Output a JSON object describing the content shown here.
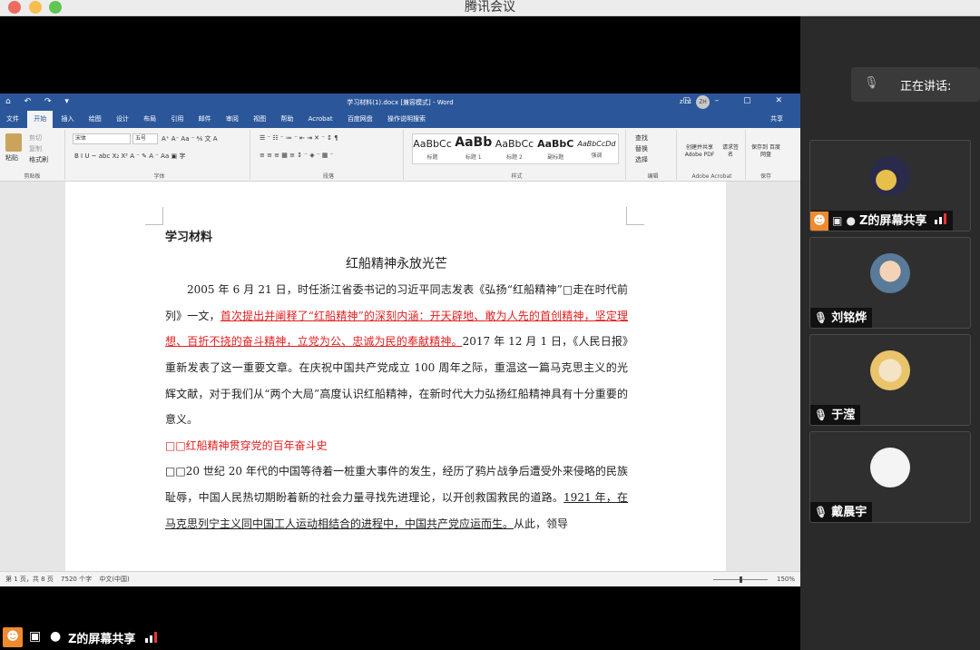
{
  "window": {
    "title": "腾讯会议",
    "colors": {
      "close": "#ed6a5e",
      "minimize": "#f5bf4f",
      "zoom": "#61c554"
    }
  },
  "word": {
    "doc_title": "学习材料(1).docx [兼容模式] - Word",
    "user": "z ht",
    "user_initials": "ZH",
    "quick_access": "⌂ ↶ ↷ ▾",
    "window_buttons": "▢ – ▢ ✕",
    "tabs": [
      "文件",
      "开始",
      "插入",
      "绘图",
      "设计",
      "布局",
      "引用",
      "邮件",
      "审阅",
      "视图",
      "帮助",
      "Acrobat",
      "百度网盘",
      "操作说明搜索"
    ],
    "active_tab": "开始",
    "share": "共享",
    "ribbon": {
      "clipboard": {
        "paste": "粘贴",
        "cut": "剪切",
        "copy": "复制",
        "format_painter": "格式刷",
        "label": "剪贴板"
      },
      "font": {
        "name": "宋体",
        "size": "五号",
        "label": "字体",
        "buttons": "B I U ~ abc X₂ X²  A ⁻ ✎ A ⁻ Aa ▣ 字",
        "size_buttons": "A⁺ A⁻  Aa ⁻  ⅍ 文 A"
      },
      "paragraph": {
        "label": "段落",
        "row1": "☰ ⁻ ☷ ⁻ ≔ ⁻  ⇤ ⇥  ✕ ⁻  ↕ ¶",
        "row2": "≡ ≡ ≡ ▦ ≡  ↕ ⁻  ◈ ⁻ ▦ ⁻"
      },
      "styles": {
        "label": "样式",
        "items": [
          {
            "sample": "AaBbCc",
            "name": "标题"
          },
          {
            "sample": "AaBb",
            "name": "标题 1"
          },
          {
            "sample": "AaBbCc",
            "name": "标题 2"
          },
          {
            "sample": "AaBbC",
            "name": "副标题"
          },
          {
            "sample": "AaBbCcDd",
            "name": "强调"
          }
        ]
      },
      "editing": {
        "label": "编辑",
        "find": "查找",
        "replace": "替换",
        "select": "选择"
      },
      "acrobat": {
        "label": "Adobe Acrobat",
        "create": "创建并共享 Adobe PDF",
        "sign": "请求签名"
      },
      "save": {
        "label": "保存",
        "baidu": "保存到 百度网盘"
      }
    },
    "document": {
      "heading": "学习材料",
      "title": "红船精神永放光芒",
      "p1_a": "2005 年 6 月 21 日，时任浙江省委书记的习近平同志发表《弘扬“红船精神”□走在时代前列》一文，",
      "p1_red": "首次提出并阐释了“红船精神”的深刻内涵：开天辟地、敢为人先的首创精神，坚定理想、百折不挠的奋斗精神，立党为公、忠诚为民的奉献精神。",
      "p1_b": "2017 年 12 月 1 日，《人民日报》重新发表了这一重要文章。在庆祝中国共产党成立 100 周年之际，重温这一篇马克思主义的光辉文献，对于我们从“两个大局”高度认识红船精神，在新时代大力弘扬红船精神具有十分重要的意义。",
      "sub1": "□□红船精神贯穿党的百年奋斗史",
      "p2_a": "□□20 世纪 20 年代的中国等待着一桩重大事件的发生，经历了鸦片战争后遭受外来侵略的民族耻辱，中国人民热切期盼着新的社会力量寻找先进理论，以开创救国救民的道路。",
      "p2_ul": "1921 年，在马克思列宁主义同中国工人运动相结合的进程中，中国共产党应运而生。",
      "p2_b": "从此，领导"
    },
    "status": {
      "page": "第 1 页，共 8 页",
      "words": "7520 个字",
      "lang": "中文(中国)",
      "zoom": "150%"
    }
  },
  "meeting": {
    "speaking_label": "正在讲话:",
    "sharer_label": "Z的屏幕共享",
    "participants": [
      {
        "name": "Z的屏幕共享",
        "muted": false,
        "sharing": true
      },
      {
        "name": "刘铭烨",
        "muted": true
      },
      {
        "name": "于滢",
        "muted": true
      },
      {
        "name": "戴晨宇",
        "muted": true
      }
    ]
  }
}
